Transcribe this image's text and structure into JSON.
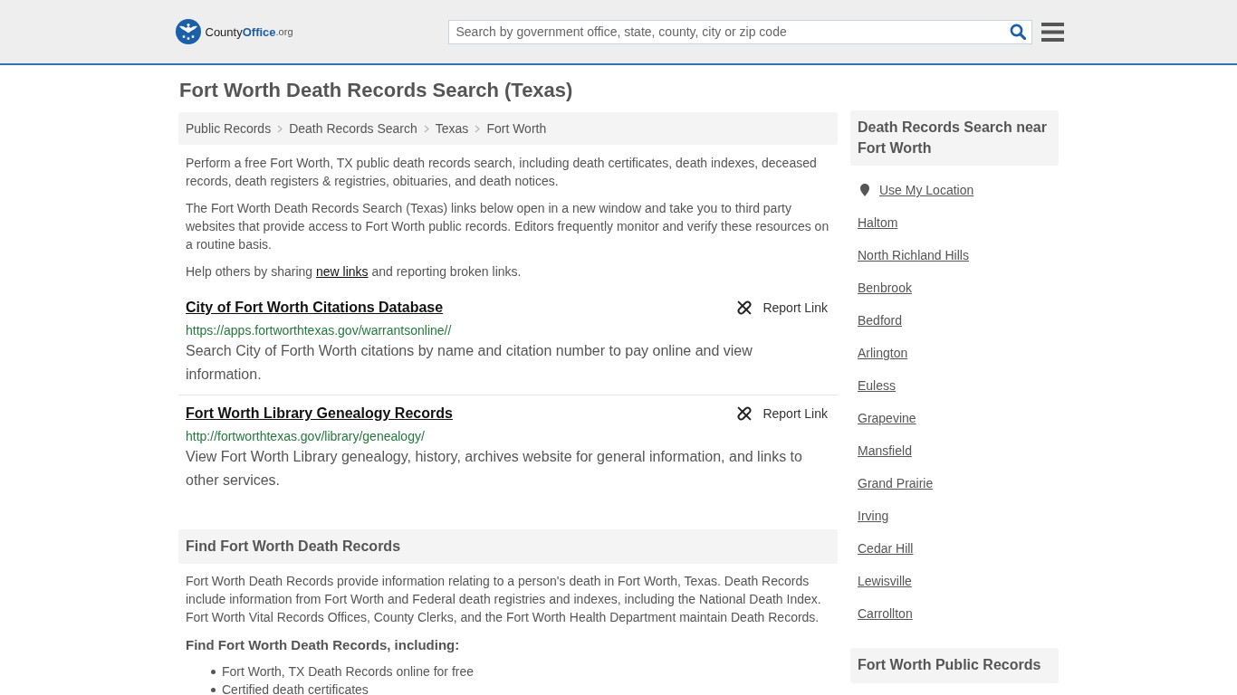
{
  "header": {
    "logo": {
      "parts": [
        "County",
        "Office",
        ".org"
      ]
    },
    "search": {
      "placeholder": "Search by government office, state, county, city or zip code"
    }
  },
  "page_title": "Fort Worth Death Records Search (Texas)",
  "breadcrumbs": [
    {
      "label": "Public Records"
    },
    {
      "label": "Death Records Search"
    },
    {
      "label": "Texas"
    },
    {
      "label": "Fort Worth"
    }
  ],
  "intro": [
    {
      "kind": "text",
      "text": "Perform a free Fort Worth, TX public death records search, including death certificates, death indexes, deceased records, death registers & registries, obituaries, and death notices."
    },
    {
      "kind": "text",
      "text": "The Fort Worth Death Records Search (Texas) links below open in a new window and take you to third party websites that provide access to Fort Worth public records. Editors frequently monitor and verify these resources on a routine basis."
    },
    {
      "kind": "link",
      "before": "Help others by sharing ",
      "link": "new links",
      "after": " and reporting broken links."
    }
  ],
  "resources": [
    {
      "title": "City of Fort Worth Citations Database",
      "url": "https://apps.fortworthtexas.gov/warrantsonline//",
      "description": "Search City of Forth Worth citations by name and citation number to pay online and view information.",
      "action": "Report Link"
    },
    {
      "title": "Fort Worth Library Genealogy Records",
      "url": "http://fortworthtexas.gov/library/genealogy/",
      "description": "View Fort Worth Library genealogy, history, archives website for general information, and links to other services.",
      "action": "Report Link"
    }
  ],
  "section": {
    "heading": "Find Fort Worth Death Records",
    "paragraph": "Fort Worth Death Records provide information relating to a person's death in Fort Worth, Texas. Death Records include information from Fort Worth and Federal death registries and indexes, including the National Death Index. Fort Worth Vital Records Offices, County Clerks, and the Fort Worth Health Department maintain Death Records.",
    "subheading": "Find Fort Worth Death Records, including:",
    "items": [
      "Fort Worth, TX Death Records online for free",
      "Certified death certificates"
    ]
  },
  "sidebar": {
    "nearby": {
      "heading": "Death Records Search near Fort Worth",
      "location_link": "Use My Location",
      "cities": [
        "Haltom",
        "North Richland Hills",
        "Benbrook",
        "Bedford",
        "Arlington",
        "Euless",
        "Grapevine",
        "Mansfield",
        "Grand Prairie",
        "Irving",
        "Cedar Hill",
        "Lewisville",
        "Carrollton"
      ]
    },
    "next_heading": "Fort Worth Public Records"
  }
}
